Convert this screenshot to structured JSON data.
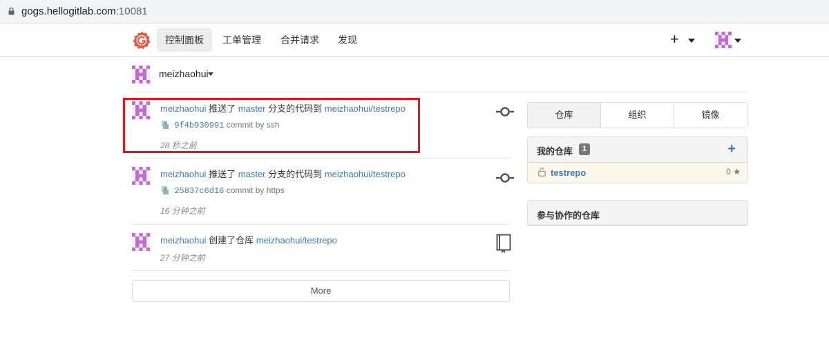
{
  "browser": {
    "url_host": "gogs.hellogitlab.com",
    "url_port": ":10081"
  },
  "nav": {
    "items": [
      {
        "label": "控制面板",
        "active": true
      },
      {
        "label": "工单管理",
        "active": false
      },
      {
        "label": "合并请求",
        "active": false
      },
      {
        "label": "发现",
        "active": false
      }
    ],
    "plus_label": "+"
  },
  "context": {
    "username": "meizhaohui"
  },
  "feed": [
    {
      "user": "meizhaohui",
      "action_push": "推送了",
      "branch": "master",
      "action_mid": "分支的代码到",
      "repo": "meizhaohui/testrepo",
      "sha": "9f4b930991",
      "commit_msg": "commit by ssh",
      "time": "28 秒之前",
      "icon": "git-commit-icon"
    },
    {
      "user": "meizhaohui",
      "action_push": "推送了",
      "branch": "master",
      "action_mid": "分支的代码到",
      "repo": "meizhaohui/testrepo",
      "sha": "25837c6d16",
      "commit_msg": "commit by https",
      "time": "16 分钟之前",
      "icon": "git-commit-icon"
    },
    {
      "user": "meizhaohui",
      "action_create": "创建了仓库",
      "repo": "meizhaohui/testrepo",
      "time": "27 分钟之前",
      "icon": "book-icon"
    }
  ],
  "more_label": "More",
  "right": {
    "tabs": [
      "仓库",
      "组织",
      "镜像"
    ],
    "my_repos_title": "我的仓库",
    "my_repos_count": "1",
    "add_label": "+",
    "repos": [
      {
        "name": "testrepo",
        "stars": "0"
      }
    ],
    "collab_title": "参与协作的仓库"
  },
  "colors": {
    "link": "#4078c0",
    "highlight": "#e8161c",
    "accent_logo": "#e05d44"
  }
}
